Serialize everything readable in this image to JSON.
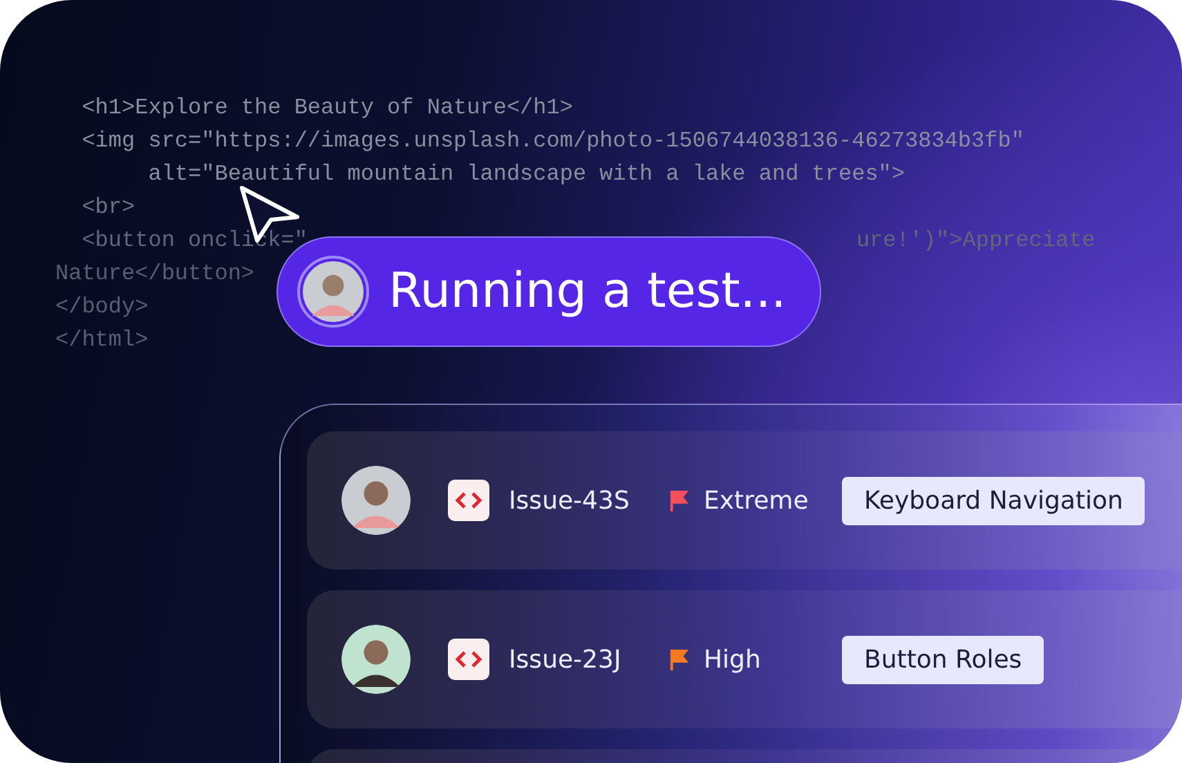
{
  "code_lines": [
    {
      "segments": [
        "  <h1>Explore the Beauty of Nature</h1>"
      ]
    },
    {
      "segments": [
        "  <img src=\"https://images.unsplash.com/photo-1506744038136-46273834b3fb\""
      ]
    },
    {
      "segments": [
        "       alt=\"Beautiful mountain landscape with a lake and trees\">"
      ]
    },
    {
      "segments": [
        "  <br>"
      ]
    },
    {
      "segments": [
        "  <button onclick=\"",
        "ure!')\">Appreciate"
      ]
    },
    {
      "segments": [
        "Nature</button>"
      ]
    },
    {
      "segments": [
        "</body>"
      ]
    },
    {
      "segments": [
        "</html>"
      ]
    }
  ],
  "status_pill": {
    "label": "Running a test..."
  },
  "issues": [
    {
      "id": "Issue-43S",
      "priority": "Extreme",
      "color": "#f2505c",
      "tag": "Keyboard Navigation"
    },
    {
      "id": "Issue-23J",
      "priority": "High",
      "color": "#f47b22",
      "tag": "Button Roles"
    }
  ]
}
